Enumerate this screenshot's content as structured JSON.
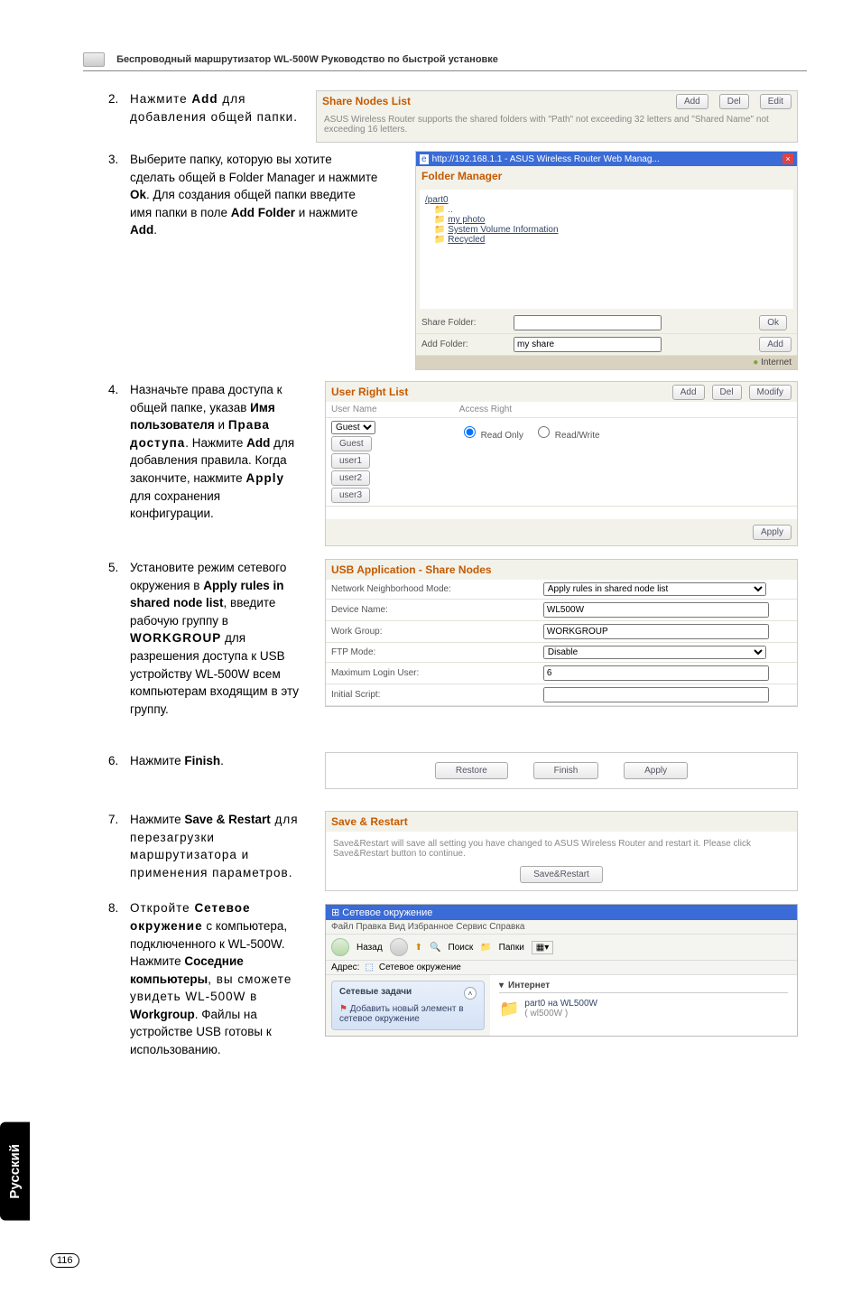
{
  "header": {
    "title": "Беспроводный маршрутизатор WL-500W Руководство по быстрой установке"
  },
  "steps": {
    "s2": {
      "num": "2.",
      "pre": "Нажмите ",
      "bold": "Add",
      "post": " для добавления общей папки."
    },
    "s3": {
      "num": "3.",
      "text_a": "Выберите папку, которую вы хотите сделать общей в Folder Manager и нажмите ",
      "ok": "Ok",
      "text_b": ". Для создания общей папки введите имя папки в поле ",
      "addfolder": "Add Folder",
      "text_c": " и нажмите ",
      "add": "Add",
      "dot": "."
    },
    "s4": {
      "num": "4.",
      "a": "Назначьте права доступа к общей папке, указав ",
      "b": "Имя пользователя",
      "c": " и ",
      "d": "Права доступа",
      "e": ". Нажмите ",
      "f": "Add",
      "g": " для добавления правила. Когда закончите, нажмите ",
      "h": "Apply",
      "i": " для сохранения конфигурации."
    },
    "s5": {
      "num": "5.",
      "a": "Установите режим сетевого окружения в ",
      "b": "Apply rules in shared node list",
      "c": ", введите рабочую группу в ",
      "d": "WORKGROUP",
      "e": " для разрешения доступа к USB устройству WL-500W всем компьютерам входящим в эту группу."
    },
    "s6": {
      "num": "6.",
      "a": "Нажмите ",
      "b": "Finish",
      "c": "."
    },
    "s7": {
      "num": "7.",
      "a": "Нажмите ",
      "b": "Save & Restart",
      "c": " для перезагрузки маршрутизатора и применения параметров."
    },
    "s8": {
      "num": "8.",
      "a": "Откройте ",
      "b": "Сетевое окружение",
      "c": " с компьютера, подключенного к WL-500W. Нажмите ",
      "d": "Соседние компьютеры",
      "e": ", вы сможете увидеть WL-500W в ",
      "f": "Workgroup",
      "g": ". Файлы на устройстве USB готовы к использованию."
    }
  },
  "share_nodes": {
    "title": "Share Nodes List",
    "btn_add": "Add",
    "btn_del": "Del",
    "btn_edit": "Edit",
    "desc": "ASUS Wireless Router supports the shared folders with \"Path\" not exceeding 32 letters and \"Shared Name\" not exceeding 16 letters."
  },
  "folder_mgr": {
    "bar": "http://192.168.1.1 - ASUS Wireless Router Web Manag...",
    "title": "Folder Manager",
    "root": "/part0",
    "link1": "my photo",
    "link2": "System Volume Information",
    "link3": "Recycled",
    "share_label": "Share Folder:",
    "add_label": "Add Folder:",
    "add_val": "my share",
    "btn_ok": "Ok",
    "btn_add": "Add",
    "footer": "Internet"
  },
  "user_right": {
    "title": "User Right List",
    "btn_add": "Add",
    "btn_del": "Del",
    "btn_mod": "Modify",
    "col1": "User Name",
    "col2": "Access Right",
    "user": "Guest",
    "ro": "Read Only",
    "rw": "Read/Write",
    "apply": "Apply"
  },
  "usb_app": {
    "title": "USB Application - Share Nodes",
    "rows": [
      {
        "l": "Network Neighborhood Mode:",
        "v": "Apply rules in shared node list"
      },
      {
        "l": "Device Name:",
        "v": "WL500W"
      },
      {
        "l": "Work Group:",
        "v": "WORKGROUP"
      },
      {
        "l": "FTP Mode:",
        "v": "Disable"
      },
      {
        "l": "Maximum Login User:",
        "v": "6"
      },
      {
        "l": "Initial Script:",
        "v": ""
      }
    ]
  },
  "fin_bar": {
    "restore": "Restore",
    "finish": "Finish",
    "apply": "Apply"
  },
  "save_restart": {
    "title": "Save & Restart",
    "desc": "Save&Restart will save all setting you have changed to ASUS Wireless Router and restart it. Please click Save&Restart button to continue.",
    "btn": "Save&Restart"
  },
  "network": {
    "title": "Сетевое окружение",
    "menu": "Файл   Правка   Вид   Избранное   Сервис   Справка",
    "back": "Назад",
    "search": "Поиск",
    "folders": "Папки",
    "addr_label": "Адрес:",
    "addr_val": "Сетевое окружение",
    "side_title": "Сетевые задачи",
    "side_item": "Добавить новый элемент в сетевое окружение",
    "main_header": "Интернет",
    "item1": "part0 на WL500W",
    "item2": "( wl500W )"
  },
  "side_tab": "Русский",
  "page_num": "116"
}
